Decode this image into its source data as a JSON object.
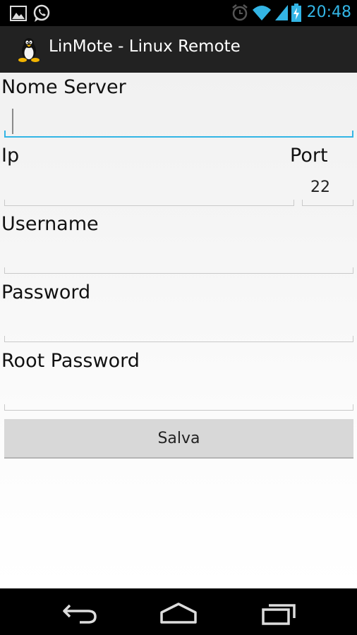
{
  "status_bar": {
    "time": "20:48",
    "icons": [
      "gallery-icon",
      "whatsapp-icon",
      "alarm-icon",
      "wifi-icon",
      "signal-icon",
      "battery-charging-icon"
    ]
  },
  "action_bar": {
    "app_icon": "linux-penguin-icon",
    "title": "LinMote - Linux Remote"
  },
  "form": {
    "server_name_label": "Nome Server",
    "server_name_value": "",
    "ip_label": "Ip",
    "ip_value": "",
    "port_label": "Port",
    "port_value": "22",
    "username_label": "Username",
    "username_value": "",
    "password_label": "Password",
    "password_value": "",
    "root_password_label": "Root Password",
    "root_password_value": "",
    "save_label": "Salva"
  },
  "nav_bar": {
    "icons": [
      "back-icon",
      "home-icon",
      "recent-apps-icon"
    ]
  },
  "colors": {
    "accent": "#33b5e5",
    "action_bar": "#222222",
    "status_bar": "#000000"
  }
}
